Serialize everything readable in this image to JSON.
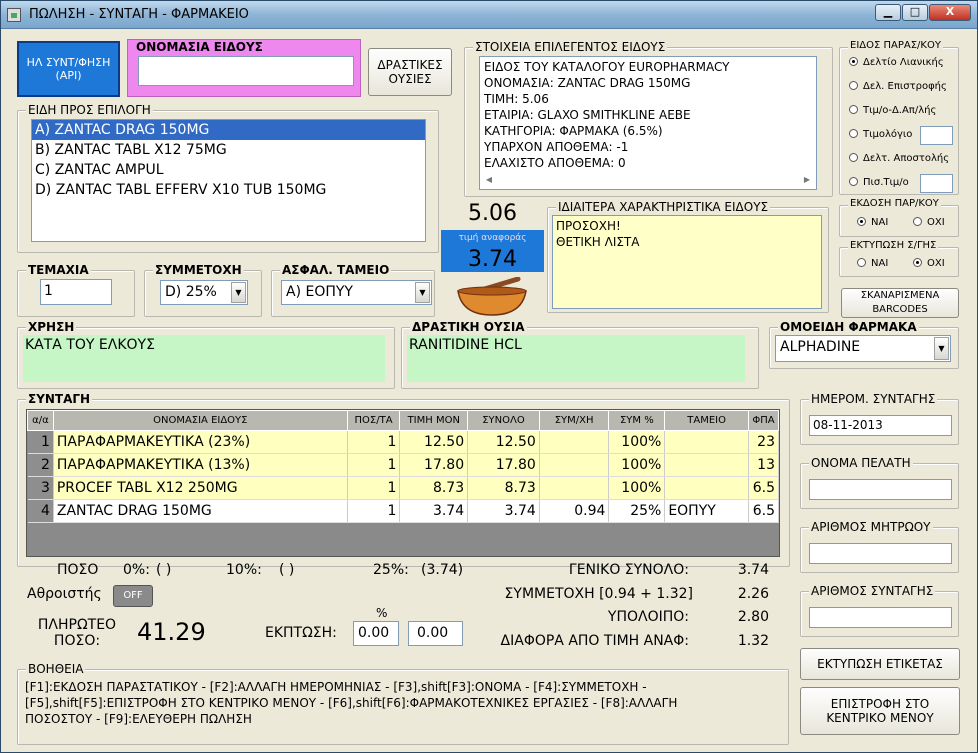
{
  "window": {
    "title": "ΠΩΛΗΣΗ - ΣΥΝΤΑΓΗ - ΦΑΡΜΑΚΕΙΟ",
    "min": "▁",
    "max": "□",
    "close": "X"
  },
  "eprescription_button": "ΗΛ ΣΥΝΤ/ΦΗΣΗ (API)",
  "item_name": {
    "legend": "ΟΝΟΜΑΣΙΑ ΕΙΔΟΥΣ",
    "value": ""
  },
  "active_substances_button": "ΔΡΑΣΤΙΚΕΣ ΟΥΣΙΕΣ",
  "selected_item": {
    "legend": "ΣΤΟΙΧΕΙΑ ΕΠΙΛΕΓΕΝΤΟΣ ΕΙΔΟΥΣ",
    "lines": [
      "ΕΙΔΟΣ ΤΟΥ ΚΑΤΑΛΟΓΟΥ EUROPHARMACY",
      "ΟΝΟΜΑΣΙΑ: ZANTAC DRAG 150MG",
      "ΤΙΜΗ: 5.06",
      "ΕΤΑΙΡΙΑ: GLAXO SMITHKLINE AEBE",
      "ΚΑΤΗΓΟΡΙΑ: ΦΑΡΜΑΚΑ (6.5%)",
      "ΥΠΑΡΧΟΝ ΑΠΟΘΕΜΑ: -1",
      "ΕΛΑΧΙΣΤΟ ΑΠΟΘΕΜΑ:  0"
    ]
  },
  "items_list": {
    "legend": "ΕΙΔΗ ΠΡΟΣ ΕΠΙΛΟΓΗ",
    "items": [
      "A) ZANTAC DRAG 150MG",
      "B) ZANTAC TABL X12 75MG",
      "C) ZANTAC AMPUL",
      "D) ZANTAC TABL EFFERV X10 TUB 150MG"
    ],
    "selected_index": 0
  },
  "price": "5.06",
  "reference_price_label": "τιμή αναφοράς",
  "reference_price": "3.74",
  "special_features": {
    "legend": "ΙΔΙΑΙΤΕΡΑ ΧΑΡΑΚΤΗΡΙΣΤΙΚΑ ΕΙΔΟΥΣ",
    "lines": [
      "ΠΡΟΣΟΧΗ!",
      "ΘΕΤΙΚΗ ΛΙΣΤΑ"
    ]
  },
  "doc_type": {
    "legend": "ΕΙΔΟΣ ΠΑΡΑΣ/ΚΟΥ",
    "options": [
      {
        "label": "Δελτίο Λιανικής",
        "checked": true
      },
      {
        "label": "Δελ. Επιστροφής",
        "checked": false
      },
      {
        "label": "Τιμ/ο-Δ.Απ/λής",
        "checked": false
      },
      {
        "label": "Τιμολόγιο",
        "checked": false
      },
      {
        "label": "Δελτ. Αποστολής",
        "checked": false
      },
      {
        "label": "Πισ.Τιμ/ο",
        "checked": false
      }
    ]
  },
  "issue_doc": {
    "legend": "ΕΚΔΟΣΗ ΠΑΡ/ΚΟΥ",
    "yes": "ΝΑΙ",
    "no": "ΟΧΙ",
    "value": "yes"
  },
  "print_prescription": {
    "legend": "ΕΚΤΥΠΩΣΗ Σ/ΓΗΣ",
    "yes": "ΝΑΙ",
    "no": "ΟΧΙ",
    "value": "no"
  },
  "scan_barcodes_button": "ΣΚΑΝΑΡΙΣΜΕΝΑ BARCODES",
  "quantity": {
    "legend": "ΤΕΜΑΧΙΑ",
    "value": "1"
  },
  "participation": {
    "legend": "ΣΥΜΜΕΤΟΧΗ",
    "value": "D) 25%"
  },
  "insurance": {
    "legend": "ΑΣΦΑΛ. ΤΑΜΕΙΟ",
    "value": "A) ΕΟΠΥΥ"
  },
  "usage": {
    "legend": "ΧΡΗΣΗ",
    "value": "ΚΑΤΑ ΤΟΥ ΕΛΚΟΥΣ"
  },
  "active_substance": {
    "legend": "ΔΡΑΣΤΙΚΗ ΟΥΣΙΑ",
    "value": "RANITIDINE HCL"
  },
  "similar_drugs": {
    "legend": "ΟΜΟΕΙΔΗ ΦΑΡΜΑΚΑ",
    "value": "ALPHADINE"
  },
  "prescription": {
    "legend": "ΣΥΝΤΑΓΗ",
    "columns": [
      "α/α",
      "ΟΝΟΜΑΣΙΑ ΕΙΔΟΥΣ",
      "ΠΟΣ/ΤΑ",
      "ΤΙΜΗ ΜΟΝ",
      "ΣΥΝΟΛΟ",
      "ΣΥΜ/ΧΗ",
      "ΣΥΜ %",
      "ΤΑΜΕΙΟ",
      "ΦΠΑ"
    ],
    "rows": [
      {
        "idx": "1",
        "name": "ΠΑΡΑΦΑΡΜΑΚΕΥΤΙΚΑ (23%)",
        "qty": "1",
        "unit": "12.50",
        "total": "12.50",
        "part": "",
        "pct": "100%",
        "fund": "",
        "vat": "23"
      },
      {
        "idx": "2",
        "name": "ΠΑΡΑΦΑΡΜΑΚΕΥΤΙΚΑ (13%)",
        "qty": "1",
        "unit": "17.80",
        "total": "17.80",
        "part": "",
        "pct": "100%",
        "fund": "",
        "vat": "13"
      },
      {
        "idx": "3",
        "name": "PROCEF TABL X12 250MG",
        "qty": "1",
        "unit": "8.73",
        "total": "8.73",
        "part": "",
        "pct": "100%",
        "fund": "",
        "vat": "6.5"
      },
      {
        "idx": "4",
        "name": "ZANTAC DRAG 150MG",
        "qty": "1",
        "unit": "3.74",
        "total": "3.74",
        "part": "0.94",
        "pct": "25%",
        "fund": "ΕΟΠΥΥ",
        "vat": "6.5"
      }
    ]
  },
  "prescription_date": {
    "legend": "ΗΜΕΡΟΜ. ΣΥΝΤΑΓΗΣ",
    "value": "08-11-2013"
  },
  "customer_name": {
    "legend": "ΟΝΟΜΑ ΠΕΛΑΤΗ",
    "value": ""
  },
  "registry_number": {
    "legend": "ΑΡΙΘΜΟΣ ΜΗΤΡΩΟΥ",
    "value": ""
  },
  "prescription_number": {
    "legend": "ΑΡΙΘΜΟΣ ΣΥΝΤΑΓΗΣ",
    "value": ""
  },
  "summary": {
    "poso_label": "ΠΟΣΟ",
    "p0_label": "0%:",
    "p0_value": "(    )",
    "p10_label": "10%:",
    "p10_value": "(    )",
    "p25_label": "25%:",
    "p25_value": "(3.74)",
    "accumulator_label": "Αθροιστής",
    "accumulator_value": "OFF",
    "payable_label": "ΠΛΗΡΩΤΕΟ ΠΟΣΟ:",
    "payable_value": "41.29",
    "discount_label": "ΕΚΠΤΩΣΗ:",
    "discount_pct_header": "%",
    "discount_pct": "0.00",
    "discount_amt": "0.00",
    "grand_total_label": "ΓΕΝΙΚΟ ΣΥΝΟΛΟ:",
    "grand_total_value": "3.74",
    "participation_label": "ΣΥΜΜΕΤΟΧΗ [0.94 + 1.32]",
    "participation_value": "2.26",
    "remainder_label": "ΥΠΟΛΟΙΠΟ:",
    "remainder_value": "2.80",
    "diff_label": "ΔΙΑΦΟΡΑ ΑΠΟ ΤΙΜΗ ΑΝΑΦ:",
    "diff_value": "1.32"
  },
  "help": {
    "legend": "ΒΟΗΘΕΙΑ",
    "text": "[F1]:ΕΚΔΟΣΗ ΠΑΡΑΣΤΑΤΙΚΟΥ - [F2]:ΑΛΛΑΓΗ ΗΜΕΡΟΜΗΝΙΑΣ - [F3],shift[F3]:ΟΝΟΜΑ - [F4]:ΣΥΜΜΕΤΟΧΗ - [F5],shift[F5]:ΕΠΙΣΤΡΟΦΗ ΣΤΟ ΚΕΝΤΡΙΚΟ ΜΕΝΟΥ - [F6],shift[F6]:ΦΑΡΜΑΚΟΤΕΧΝΙΚΕΣ ΕΡΓΑΣΙΕΣ - [F8]:ΑΛΛΑΓΗ ΠΟΣΟΣΤΟΥ - [F9]:ΕΛΕΥΘΕΡΗ ΠΩΛΗΣΗ"
  },
  "print_label_button": "ΕΚΤΥΠΩΣΗ ΕΤΙΚΕΤΑΣ",
  "return_main_button": "ΕΠΙΣΤΡΟΦΗ ΣΤΟ ΚΕΝΤΡΙΚΟ ΜΕΝΟΥ",
  "colors": {
    "highlight": "#316ac5",
    "green_field": "#c6f5c6",
    "yellow_field": "#ffffc8",
    "ref_price_bg": "#1e78d8"
  }
}
